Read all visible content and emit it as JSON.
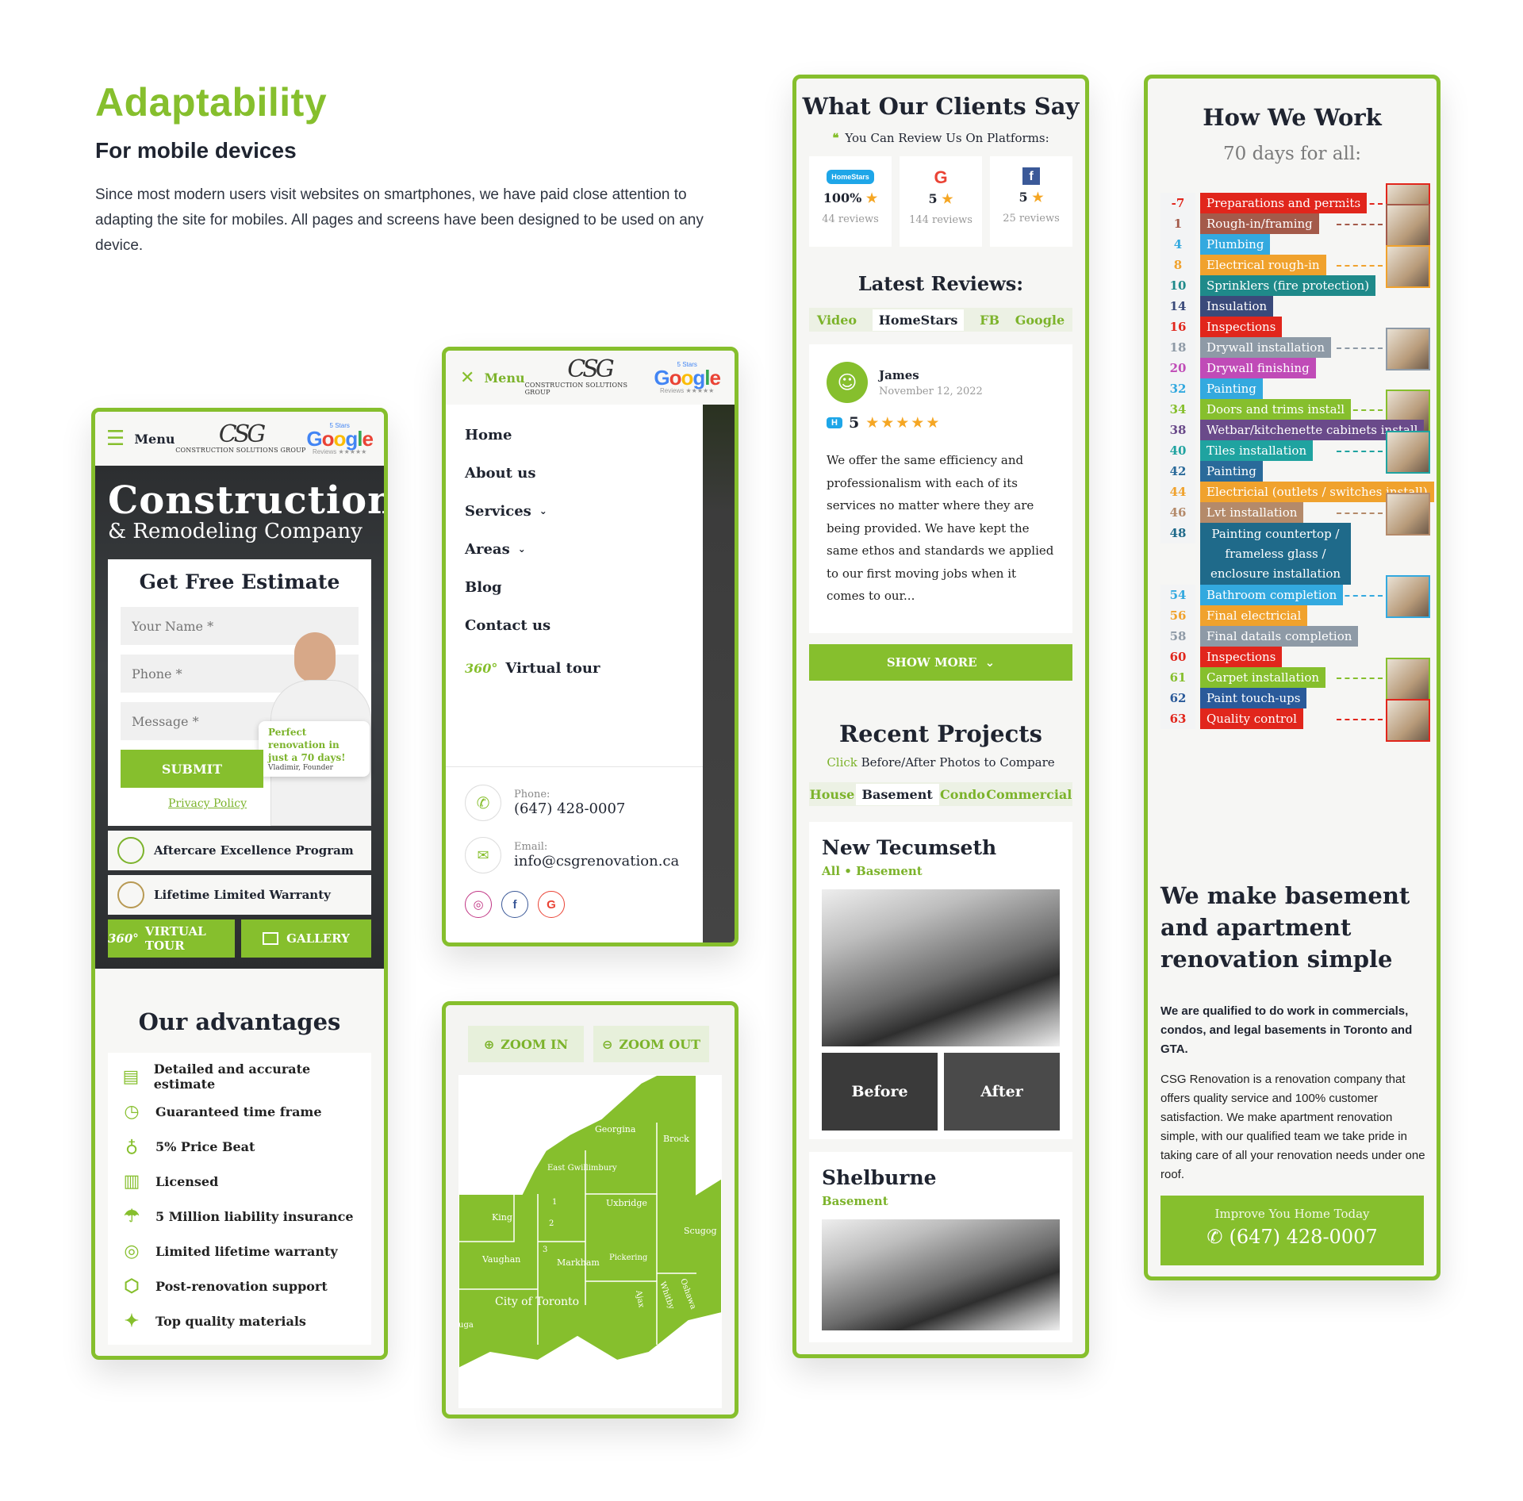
{
  "intro": {
    "heading": "Adaptability",
    "subheading": "For mobile devices",
    "paragraph": "Since most modern users visit websites on smartphones, we have paid close attention to adapting the site for mobiles. All pages and screens have been designed to be used on any device."
  },
  "colors": {
    "accent": "#86bf2d",
    "dark": "#1f2430"
  },
  "header": {
    "menu_label": "Menu",
    "logo_text": "CSG",
    "logo_sub": "CONSTRUCTION SOLUTIONS GROUP",
    "google_top": "5 Stars",
    "google_word": [
      "G",
      "o",
      "o",
      "g",
      "l",
      "e"
    ],
    "google_bottom": "Reviews ★★★★★"
  },
  "phone1": {
    "hero_title": "Construction",
    "hero_sub": "& Remodeling Company",
    "form_title": "Get Free Estimate",
    "name_placeholder": "Your Name *",
    "phone_placeholder": "Phone *",
    "message_placeholder": "Message *",
    "submit_label": "SUBMIT",
    "privacy_label": "Privacy Policy",
    "quote_text": "Perfect renovation in just a 70 days!",
    "quote_author": "Vladimir, Founder",
    "program_label": "Aftercare Excellence Program",
    "warranty_label": "Lifetime Limited Warranty",
    "virtual_tour_label": "VIRTUAL TOUR",
    "gallery_label": "GALLERY",
    "advantages_title": "Our advantages",
    "advantages": [
      {
        "icon": "estimate-icon",
        "label": "Detailed and accurate estimate"
      },
      {
        "icon": "clock-icon",
        "label": "Guaranteed time frame"
      },
      {
        "icon": "price-icon",
        "label": "5% Price Beat"
      },
      {
        "icon": "license-icon",
        "label": "Licensed"
      },
      {
        "icon": "umbrella-icon",
        "label": "5 Million liability insurance"
      },
      {
        "icon": "warranty-icon",
        "label": "Limited lifetime warranty"
      },
      {
        "icon": "support-icon",
        "label": "Post-renovation support"
      },
      {
        "icon": "quality-icon",
        "label": "Top quality materials"
      }
    ]
  },
  "phone2": {
    "menu_items": [
      {
        "label": "Home",
        "chevron": false
      },
      {
        "label": "About us",
        "chevron": false
      },
      {
        "label": "Services",
        "chevron": true
      },
      {
        "label": "Areas",
        "chevron": true
      },
      {
        "label": "Blog",
        "chevron": false
      },
      {
        "label": "Contact us",
        "chevron": false
      }
    ],
    "virtual_tour": "Virtual tour",
    "tour_badge": "360°",
    "phone_label": "Phone:",
    "phone_value": "(647) 428-0007",
    "email_label": "Email:",
    "email_value": "info@csgrenovation.ca"
  },
  "map": {
    "zoom_in": "ZOOM IN",
    "zoom_out": "ZOOM OUT",
    "regions": [
      "Georgina",
      "Brock",
      "East Gwillimbury",
      "Uxbridge",
      "King",
      "1",
      "2",
      "3",
      "Scugog",
      "Vaughan",
      "Markham",
      "Pickering",
      "Whitby",
      "Oshawa",
      "Ajax",
      "City of Toronto",
      "uga"
    ]
  },
  "phone3": {
    "title": "What Our Clients Say",
    "review_prompt": "You Can Review Us On Platforms:",
    "platforms": [
      {
        "icon": "homestars-icon",
        "badge": "HomeStars",
        "score": "100%",
        "reviews": "44 reviews"
      },
      {
        "icon": "google-icon",
        "badge": "G",
        "score": "5",
        "reviews": "144 reviews"
      },
      {
        "icon": "facebook-icon",
        "badge": "f",
        "score": "5",
        "reviews": "25 reviews"
      }
    ],
    "latest_title": "Latest Reviews:",
    "review_tabs": [
      "Video",
      "HomeStars",
      "FB",
      "Google"
    ],
    "active_review_tab": "HomeStars",
    "reviewer_name": "James",
    "review_date": "November 12, 2022",
    "review_badge": "H",
    "review_score": "5",
    "review_stars": 5,
    "review_text": "We offer the same efficiency and professionalism with each of its services no matter where they are being provided. We have kept the same ethos and standards we applied to our first moving jobs when it comes to our...",
    "show_more": "SHOW MORE",
    "projects_title": "Recent Projects",
    "projects_hint_click": "Click",
    "projects_hint_rest": "Before/After Photos to Compare",
    "project_tabs": [
      "House",
      "Basement",
      "Condo",
      "Commercial"
    ],
    "active_project_tab": "Basement",
    "projects": [
      {
        "name": "New Tecumseth",
        "tags": "All • Basement",
        "before": "Before",
        "after": "After"
      },
      {
        "name": "Shelburne",
        "tags": "Basement"
      }
    ]
  },
  "phone4": {
    "title": "How We Work",
    "subtitle": "70 days for all:",
    "steps": [
      {
        "day": "-7",
        "label": "Preparations and permits",
        "color": "#e1261c"
      },
      {
        "day": "1",
        "label": "Rough-in/framing",
        "color": "#a45a4a"
      },
      {
        "day": "4",
        "label": "Plumbing",
        "color": "#33a9df"
      },
      {
        "day": "8",
        "label": "Electrical rough-in",
        "color": "#f0a22d"
      },
      {
        "day": "10",
        "label": "Sprinklers (fire protection)",
        "color": "#1f8a8a"
      },
      {
        "day": "14",
        "label": "Insulation",
        "color": "#3a4a7a"
      },
      {
        "day": "16",
        "label": "Inspections",
        "color": "#e1261c"
      },
      {
        "day": "18",
        "label": "Drywall installation",
        "color": "#8e9aa6"
      },
      {
        "day": "20",
        "label": "Drywall finishing",
        "color": "#c04bb7"
      },
      {
        "day": "32",
        "label": "Painting",
        "color": "#33a9df"
      },
      {
        "day": "34",
        "label": "Doors and trims install",
        "color": "#86bf2d"
      },
      {
        "day": "38",
        "label": "Wetbar/kitchenette cabinets install",
        "color": "#6a4a8a"
      },
      {
        "day": "40",
        "label": "Tiles installation",
        "color": "#1fa3a0"
      },
      {
        "day": "42",
        "label": "Painting",
        "color": "#2a6a9a"
      },
      {
        "day": "44",
        "label": "Electricial (outlets / switches install)",
        "color": "#f0a22d"
      },
      {
        "day": "46",
        "label": "Lvt installation",
        "color": "#b48a6a"
      },
      {
        "day": "48",
        "label": "Painting countertop / frameless glass / enclosure installation",
        "color": "#1f6a8a"
      },
      {
        "day": "54",
        "label": "Bathroom completion",
        "color": "#33a9df"
      },
      {
        "day": "56",
        "label": "Final electricial",
        "color": "#f0a22d"
      },
      {
        "day": "58",
        "label": "Final datails completion",
        "color": "#8e9aa6"
      },
      {
        "day": "60",
        "label": "Inspections",
        "color": "#e1261c"
      },
      {
        "day": "61",
        "label": "Carpet installation",
        "color": "#86bf2d"
      },
      {
        "day": "62",
        "label": "Paint touch-ups",
        "color": "#2a5a9a"
      },
      {
        "day": "63",
        "label": "Quality control",
        "color": "#e1261c"
      }
    ],
    "headline": "We make basement and apartment renovation simple",
    "qualified": "We are qualified to do work in commercials, condos, and legal basements in Toronto and GTA.",
    "body": "CSG Renovation is a renovation company that offers quality service and 100% customer satisfaction. We make apartment renovation simple, with our qualified team we take pride in taking care of all your renovation needs under one roof.",
    "cta_top": "Improve You Home Today",
    "cta_phone": "(647) 428-0007"
  }
}
